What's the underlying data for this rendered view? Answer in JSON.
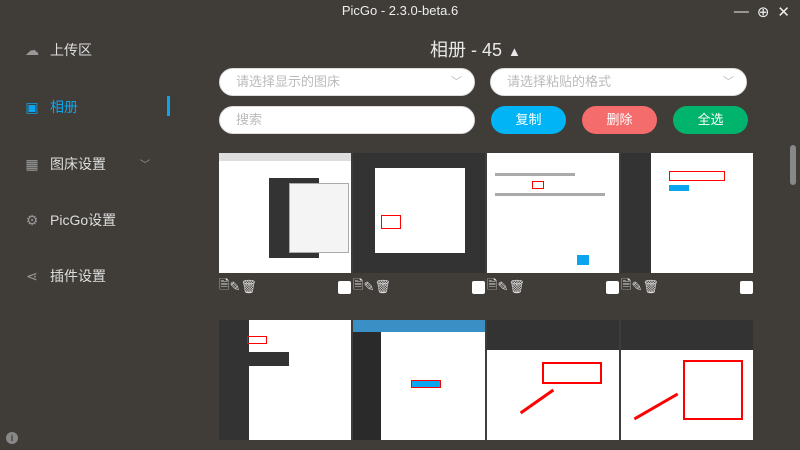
{
  "window": {
    "title": "PicGo - 2.3.0-beta.6",
    "minimize": "—",
    "maximize": "⊕",
    "close": "✕"
  },
  "sidebar": {
    "items": [
      {
        "label": "上传区",
        "icon": "cloud-upload-icon"
      },
      {
        "label": "相册",
        "icon": "image-icon",
        "active": true
      },
      {
        "label": "图床设置",
        "icon": "grid-icon"
      },
      {
        "label": "PicGo设置",
        "icon": "gear-icon"
      },
      {
        "label": "插件设置",
        "icon": "share-icon"
      }
    ],
    "info": "i"
  },
  "main": {
    "title": "相册 - 45",
    "sort_icon": "▲",
    "bed_select_placeholder": "请选择显示的图床",
    "format_select_placeholder": "请选择粘贴的格式",
    "search_placeholder": "搜索",
    "copy": "复制",
    "delete": "删除",
    "select_all": "全选",
    "colors": {
      "accent": "#0ba4ee",
      "copy": "#00b4f5",
      "delete": "#f56c6c",
      "select_all": "#00b46e"
    }
  },
  "gallery": {
    "count_visible": 8
  }
}
